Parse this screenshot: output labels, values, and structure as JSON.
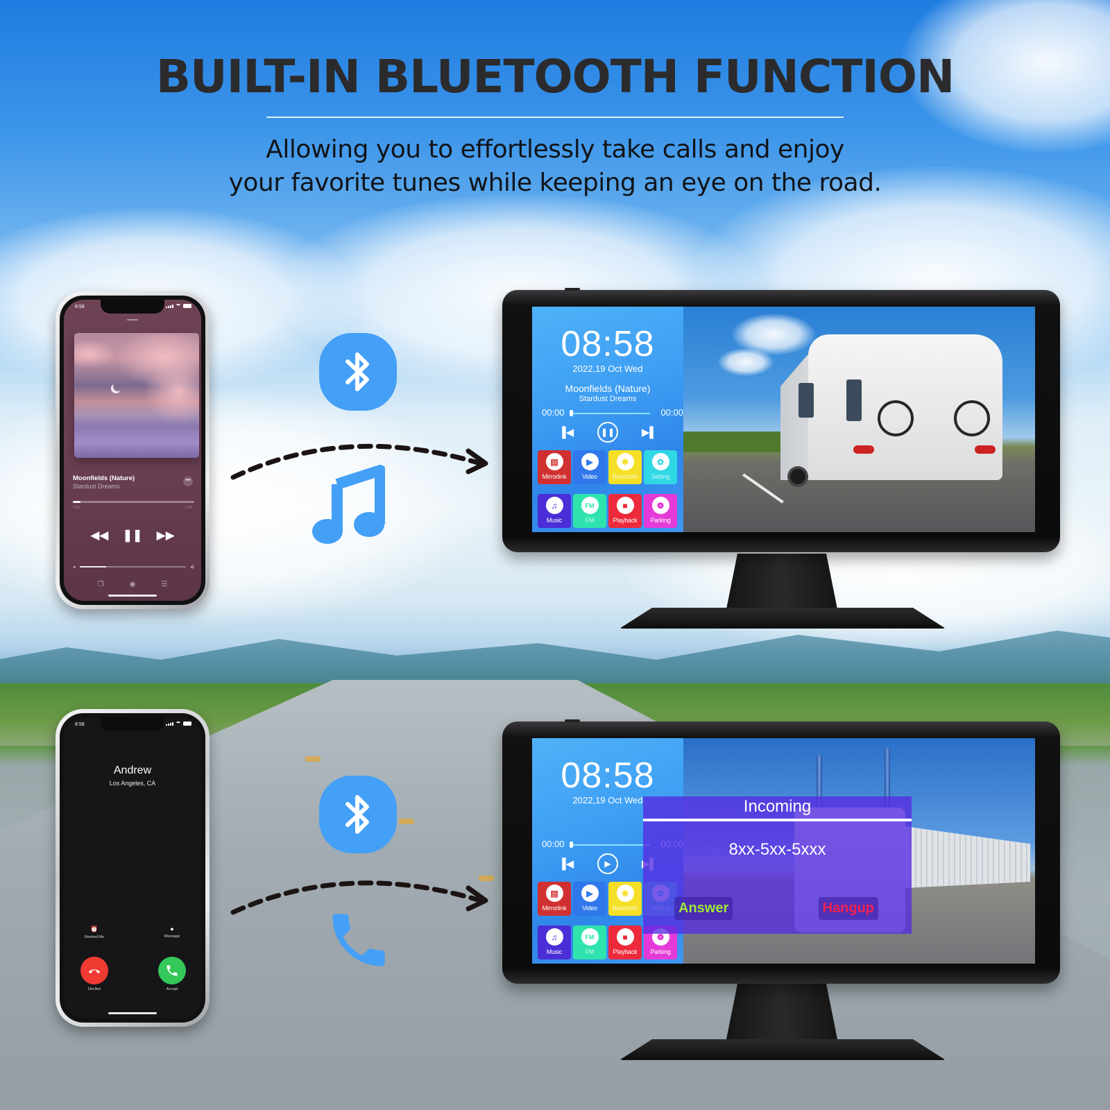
{
  "header": {
    "title": "BUILT-IN BLUETOOTH FUNCTION",
    "subtitle_line1": "Allowing you to effortlessly take calls and enjoy",
    "subtitle_line2": "your favorite tunes while keeping an eye on the road."
  },
  "colors": {
    "accent_blue": "#449ff6",
    "title_text": "#2b2b2d",
    "answer_green": "#9ee838",
    "hangup_red": "#f0234e",
    "incoming_overlay": "#562be2"
  },
  "music_phone": {
    "status_time": "8:58",
    "song_title": "Moonfields (Nature)",
    "artist": "Stardust Dreams",
    "elapsed": "0:09",
    "remaining": "-2:38",
    "progress_fraction": 0.06,
    "volume_fraction": 0.25,
    "controls": {
      "rewind_icon": "rewind-icon",
      "pause_icon": "pause-icon",
      "forward_icon": "fast-forward-icon"
    },
    "more_label": "•••"
  },
  "call_phone": {
    "status_time": "8:58",
    "caller_name": "Andrew",
    "caller_location": "Los Angeles, CA",
    "remind_label": "Remind Me",
    "message_label": "Message",
    "decline_label": "Decline",
    "accept_label": "Accept"
  },
  "connection_icons": {
    "top": [
      "bluetooth-icon",
      "music-note-icon"
    ],
    "bottom": [
      "bluetooth-icon",
      "phone-icon"
    ]
  },
  "monitor_top": {
    "clock": "08:58",
    "date": "2022,19  Oct  Wed",
    "song_title": "Moonfields (Nature)",
    "artist": "Stardust Dreams",
    "time_start": "00:00",
    "time_end": "00:00",
    "play_state": "pause",
    "tiles": [
      {
        "label": "Mirrorlink",
        "glyph": "▤",
        "color": "#d0302f",
        "icon_color": "#d0302f"
      },
      {
        "label": "Video",
        "glyph": "▶",
        "color": "#2f77ea",
        "icon_color": "#2f77ea"
      },
      {
        "label": "Bluetooth",
        "glyph": "✱",
        "color": "#f5e027",
        "icon_color": "#f5e027"
      },
      {
        "label": "Setting",
        "glyph": "✿",
        "color": "#30d8e6",
        "icon_color": "#30d8e6"
      },
      {
        "label": "Music",
        "glyph": "♫",
        "color": "#4a2ed6",
        "icon_color": "#4a2ed6"
      },
      {
        "label": "FM",
        "glyph": "FM",
        "color": "#2ee3ae",
        "icon_color": "#2ee3ae"
      },
      {
        "label": "Playback",
        "glyph": "■",
        "color": "#ec2a3c",
        "icon_color": "#ec2a3c"
      },
      {
        "label": "Parking",
        "glyph": "❁",
        "color": "#e43bd8",
        "icon_color": "#e43bd8"
      }
    ]
  },
  "monitor_bottom": {
    "clock": "08:58",
    "date": "2022,19  Oct  Wed",
    "time_start": "00:00",
    "time_end": "00:00",
    "play_state": "play",
    "tiles": [
      {
        "label": "Mirrorlink",
        "glyph": "▤",
        "color": "#d0302f",
        "icon_color": "#d0302f"
      },
      {
        "label": "Video",
        "glyph": "▶",
        "color": "#2f77ea",
        "icon_color": "#2f77ea"
      },
      {
        "label": "Bluetooth",
        "glyph": "✱",
        "color": "#f5e027",
        "icon_color": "#f5e027"
      },
      {
        "label": "Setting",
        "glyph": "✿",
        "color": "#30d8e6",
        "icon_color": "#30d8e6"
      },
      {
        "label": "Music",
        "glyph": "♫",
        "color": "#4a2ed6",
        "icon_color": "#4a2ed6"
      },
      {
        "label": "FM",
        "glyph": "FM",
        "color": "#2ee3ae",
        "icon_color": "#2ee3ae"
      },
      {
        "label": "Playback",
        "glyph": "■",
        "color": "#ec2a3c",
        "icon_color": "#ec2a3c"
      },
      {
        "label": "Parking",
        "glyph": "❁",
        "color": "#e43bd8",
        "icon_color": "#e43bd8"
      }
    ],
    "incoming": {
      "title": "Incoming",
      "number": "8xx-5xx-5xxx",
      "answer_label": "Answer",
      "hangup_label": "Hangup"
    }
  }
}
